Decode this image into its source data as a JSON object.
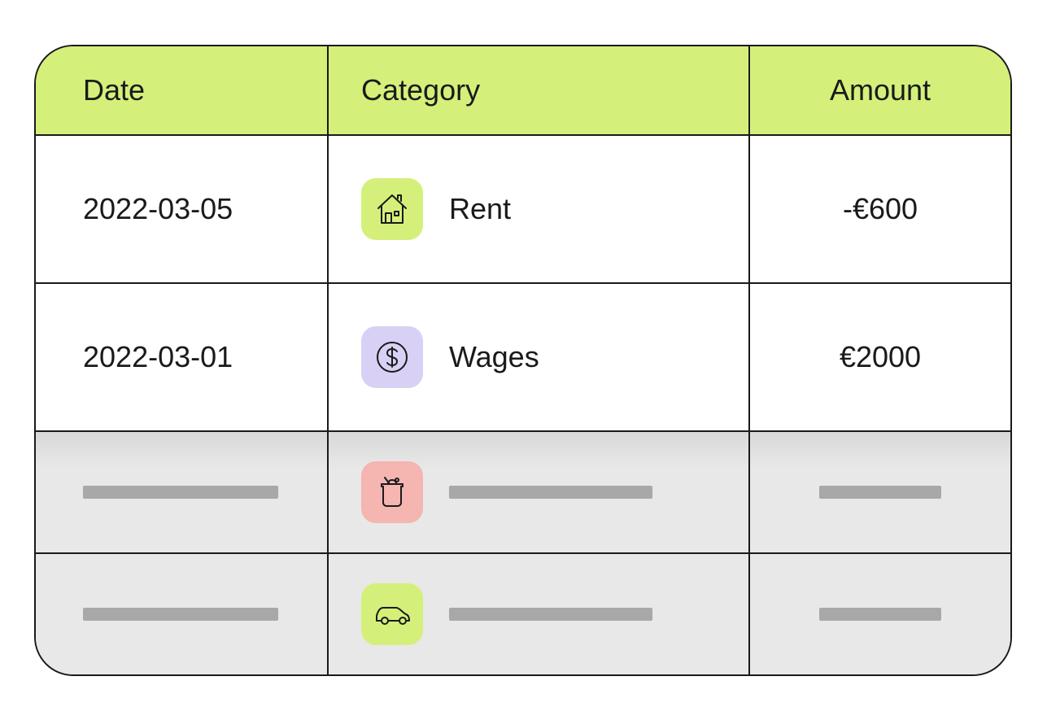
{
  "table": {
    "headers": {
      "date": "Date",
      "category": "Category",
      "amount": "Amount"
    },
    "rows": [
      {
        "date": "2022-03-05",
        "category": "Rent",
        "amount": "-€600",
        "icon": "house-icon",
        "iconColor": "green"
      },
      {
        "date": "2022-03-01",
        "category": "Wages",
        "amount": "€2000",
        "icon": "dollar-icon",
        "iconColor": "purple"
      }
    ],
    "placeholderRows": [
      {
        "icon": "groceries-icon",
        "iconColor": "pink"
      },
      {
        "icon": "car-icon",
        "iconColor": "green"
      }
    ]
  },
  "colors": {
    "headerBg": "#d4f07a",
    "green": "#d4f07a",
    "purple": "#d8d1f5",
    "pink": "#f5b5b0",
    "placeholderBg": "#e8e8e8",
    "placeholderBar": "#a8a8a8"
  }
}
